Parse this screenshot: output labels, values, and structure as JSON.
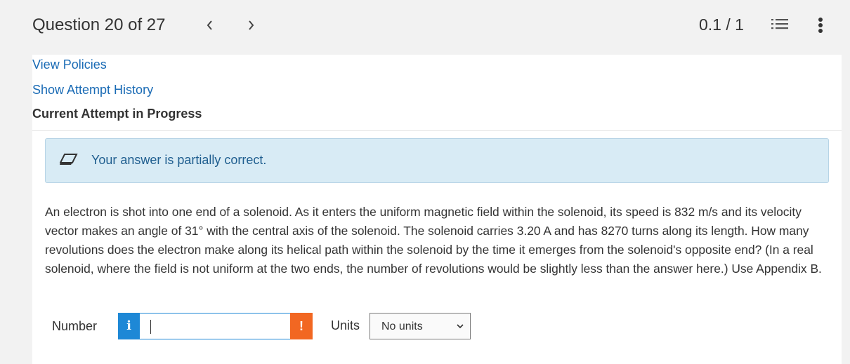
{
  "header": {
    "question_label": "Question 20 of 27",
    "prev_icon": "chevron-left-icon",
    "next_icon": "chevron-right-icon",
    "score": "0.1 / 1",
    "list_icon": "numbered-list-icon",
    "more_icon": "vertical-ellipsis-icon"
  },
  "links": {
    "view_policies": "View Policies",
    "show_attempt_history": "Show Attempt History"
  },
  "attempt": {
    "heading": "Current Attempt in Progress"
  },
  "feedback": {
    "icon": "eraser-icon",
    "text": "Your answer is partially correct."
  },
  "question": {
    "text": "An electron is shot into one end of a solenoid. As it enters the uniform magnetic field within the solenoid, its speed is 832 m/s and its velocity vector makes an angle of 31° with the central axis of the solenoid. The solenoid carries 3.20 A and has 8270 turns along its length. How many revolutions does the electron make along its helical path within the solenoid by the time it emerges from the solenoid's opposite end? (In a real solenoid, where the field is not uniform at the two ends, the number of revolutions would be slightly less than the answer here.) Use Appendix B."
  },
  "answer": {
    "number_label": "Number",
    "info_glyph": "i",
    "number_value": "",
    "warn_glyph": "!",
    "units_label": "Units",
    "units_selected": "No units"
  },
  "colors": {
    "link": "#1a6bb5",
    "feedback_bg": "#d8ebf5",
    "info_blue": "#1e88d6",
    "warn_orange": "#f26722"
  }
}
